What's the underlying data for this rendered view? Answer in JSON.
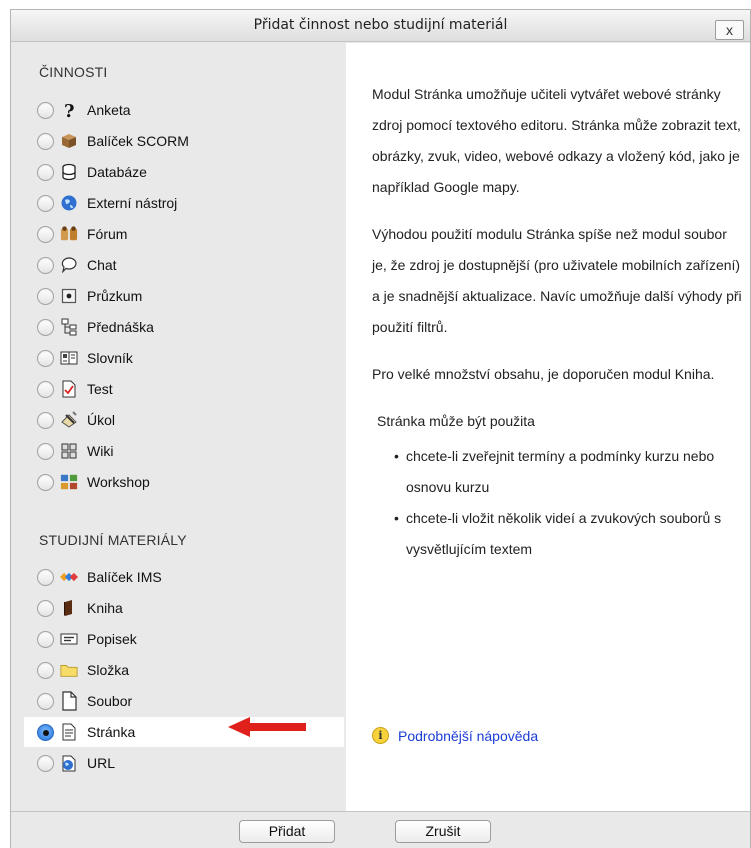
{
  "dialog": {
    "title": "Přidat činnost nebo studijní materiál",
    "close_label": "x"
  },
  "activities": {
    "heading": "ČINNOSTI",
    "items": [
      {
        "label": "Anketa",
        "icon": "question-icon"
      },
      {
        "label": "Balíček SCORM",
        "icon": "package-icon"
      },
      {
        "label": "Databáze",
        "icon": "database-icon"
      },
      {
        "label": "Externí nástroj",
        "icon": "globe-icon"
      },
      {
        "label": "Fórum",
        "icon": "forum-icon"
      },
      {
        "label": "Chat",
        "icon": "chat-icon"
      },
      {
        "label": "Průzkum",
        "icon": "survey-icon"
      },
      {
        "label": "Přednáška",
        "icon": "lesson-icon"
      },
      {
        "label": "Slovník",
        "icon": "glossary-icon"
      },
      {
        "label": "Test",
        "icon": "quiz-icon"
      },
      {
        "label": "Úkol",
        "icon": "assignment-icon"
      },
      {
        "label": "Wiki",
        "icon": "wiki-icon"
      },
      {
        "label": "Workshop",
        "icon": "workshop-icon"
      }
    ]
  },
  "resources": {
    "heading": "STUDIJNÍ MATERIÁLY",
    "items": [
      {
        "label": "Balíček IMS",
        "icon": "ims-icon"
      },
      {
        "label": "Kniha",
        "icon": "book-icon"
      },
      {
        "label": "Popisek",
        "icon": "label-icon"
      },
      {
        "label": "Složka",
        "icon": "folder-icon"
      },
      {
        "label": "Soubor",
        "icon": "file-icon"
      },
      {
        "label": "Stránka",
        "icon": "page-icon",
        "selected": true
      },
      {
        "label": "URL",
        "icon": "url-icon"
      }
    ]
  },
  "description": {
    "p1": "Modul Stránka umožňuje učiteli vytvářet webové stránky zdroj pomocí textového editoru. Stránka může zobrazit text, obrázky, zvuk, video, webové odkazy a vložený kód, jako je například Google mapy.",
    "p2": "Výhodou použití modulu Stránka spíše než modul soubor je, že zdroj je dostupnější (pro uživatele mobilních zařízení) a je snadnější aktualizace. Navíc umožňuje další výhody při použití filtrů.",
    "p3": "Pro velké množství obsahu, je doporučen modul Kniha.",
    "p4": "Stránka může být použita",
    "bullets": [
      "chcete-li zveřejnit termíny a podmínky kurzu nebo osnovu kurzu",
      "chcete-li vložit několik videí a zvukových souborů s vysvětlujícím textem"
    ],
    "help_link": "Podrobnější nápověda",
    "help_icon_glyph": "i"
  },
  "footer": {
    "add_label": "Přidat",
    "cancel_label": "Zrušit"
  },
  "colors": {
    "link": "#1a3dd6",
    "arrow": "#e0201b",
    "selected_radio": "#2173d9"
  }
}
